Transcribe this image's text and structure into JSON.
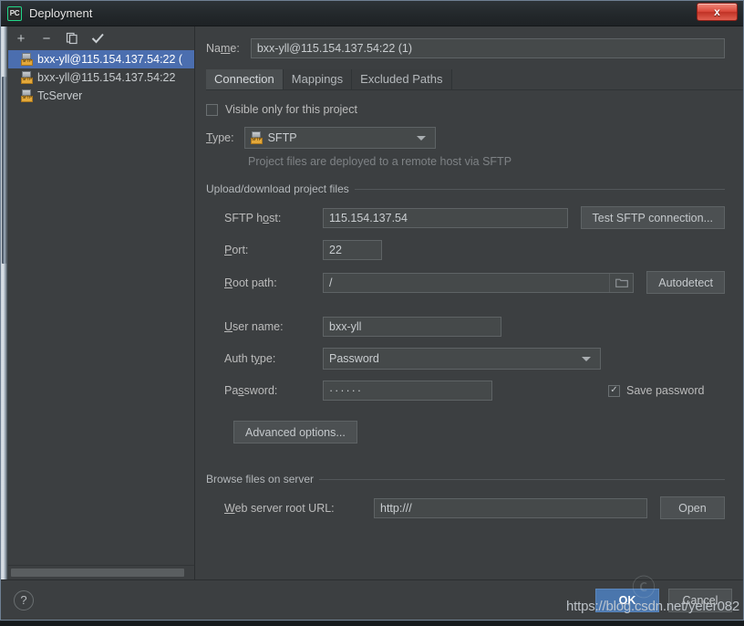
{
  "window": {
    "title": "Deployment",
    "app_icon": "PC",
    "close_label": "x",
    "close_icon": "close-icon"
  },
  "sidebar": {
    "toolbar": [
      {
        "name": "add-button",
        "glyph": "+"
      },
      {
        "name": "remove-button",
        "glyph": "−"
      },
      {
        "name": "copy-button",
        "glyph": "copy"
      },
      {
        "name": "set-default-button",
        "glyph": "✓"
      }
    ],
    "items": [
      {
        "label": "bxx-yll@115.154.137.54:22 (",
        "icon": "sftp-icon",
        "selected": true
      },
      {
        "label": "bxx-yll@115.154.137.54:22",
        "icon": "sftp-icon",
        "selected": false
      },
      {
        "label": "TcServer",
        "icon": "sftp-icon",
        "selected": false
      }
    ],
    "icon_tag": "SFTP"
  },
  "name_field": {
    "label": "Name:",
    "label_pre": "Na",
    "label_mnemonic": "m",
    "label_post": "e:",
    "value": "bxx-yll@115.154.137.54:22 (1)"
  },
  "tabs": [
    {
      "label": "Connection",
      "active": true
    },
    {
      "label": "Mappings",
      "active": false
    },
    {
      "label": "Excluded Paths",
      "active": false
    }
  ],
  "connection": {
    "visible_only": {
      "label": "Visible only for this project",
      "checked": false
    },
    "type": {
      "label": "Type:",
      "label_mnemonic": "T",
      "label_post": "ype:",
      "value": "SFTP",
      "icon": "sftp-icon",
      "hint": "Project files are deployed to a remote host via SFTP"
    },
    "upload_group": {
      "title": "Upload/download project files",
      "host": {
        "label": "SFTP host:",
        "value": "115.154.137.54"
      },
      "test_button": "Test SFTP connection...",
      "port": {
        "label": "Port:",
        "value": "22"
      },
      "root": {
        "label": "Root path:",
        "value": "/",
        "browse_icon": "folder-icon"
      },
      "autodetect_button": "Autodetect",
      "username": {
        "label": "User name:",
        "value": "bxx-yll"
      },
      "auth_type": {
        "label": "Auth type:",
        "value": "Password"
      },
      "password": {
        "label": "Password:",
        "value": "······"
      },
      "save_password": {
        "label": "Save password",
        "checked": true
      },
      "advanced_button": "Advanced options..."
    },
    "browse_group": {
      "title": "Browse files on server",
      "web_url": {
        "label": "Web server root URL:",
        "value": "http:///"
      },
      "open_button": "Open"
    }
  },
  "footer": {
    "help_label": "?",
    "ok_label": "OK",
    "cancel_label": "Cancel"
  },
  "watermark": {
    "text": "https://blog.csdn.net/yeler082",
    "mark": "ⓒ"
  },
  "colors": {
    "dialog_bg": "#3c3f41",
    "selection_blue": "#4b6eaf",
    "ok_blue": "#4a76ad",
    "input_bg": "#45494a",
    "sftp_tag": "#e3a83a",
    "close_red": "#d9483a"
  }
}
